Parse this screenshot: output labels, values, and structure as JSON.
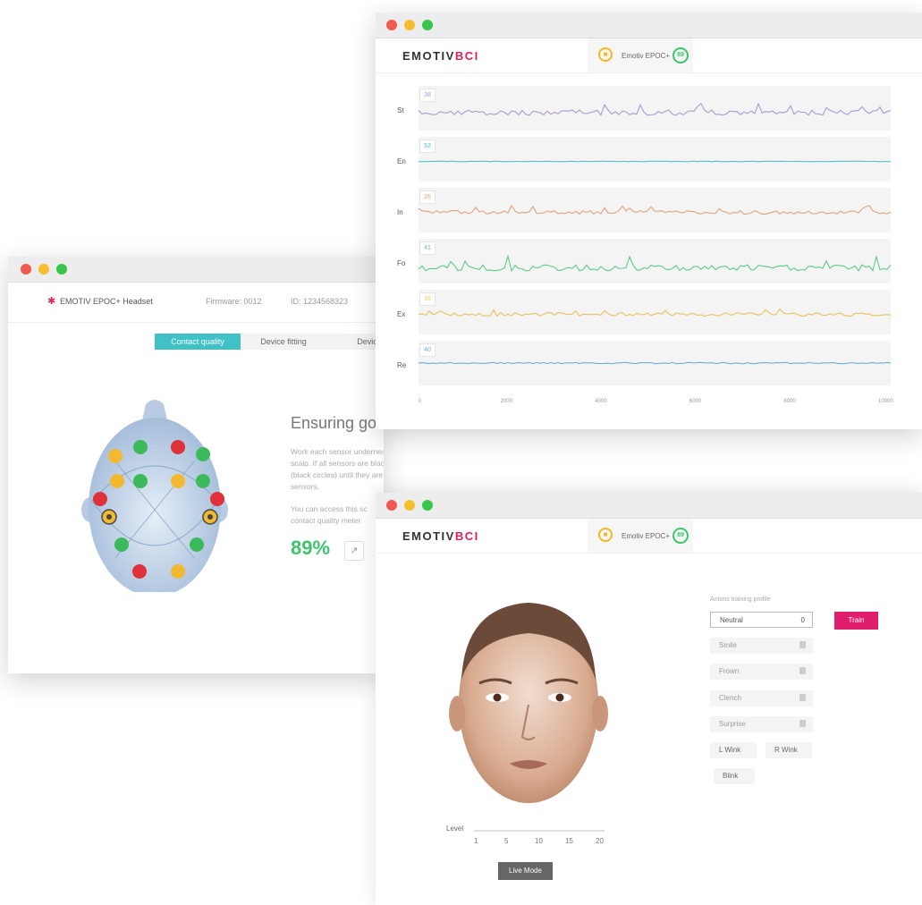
{
  "contact_window": {
    "device_name": "EMOTIV EPOC+ Headset",
    "firmware": "Firmware: 0012",
    "device_id": "ID: 1234568323",
    "tabs": [
      "Contact quality",
      "Device fitting",
      "Device"
    ],
    "heading": "Ensuring goc",
    "paragraph1": "Work each sensor underneath hair to make contact with the scalp. If all sensors are black, first adjust the reference sensors (black circles) until they are green, and then adjust the other sensors.",
    "paragraph2": "You can access this sc contact quality meter",
    "quality_percent": "89%",
    "sensor_colors": {
      "green": "#3cb95a",
      "yellow": "#f2b830",
      "red": "#e0303a"
    }
  },
  "performance_window": {
    "logo_main": "EMOTIV",
    "logo_accent": "BCI",
    "device_tab": "Emotiv EPOC+",
    "battery": "89",
    "channels": [
      {
        "label": "St",
        "value": "38",
        "color": "#a89bd0"
      },
      {
        "label": "En",
        "value": "52",
        "color": "#56c1cc"
      },
      {
        "label": "In",
        "value": "26",
        "color": "#e2a27a"
      },
      {
        "label": "Fo",
        "value": "41",
        "color": "#5ccb8a"
      },
      {
        "label": "Ex",
        "value": "16",
        "color": "#e8c15a"
      },
      {
        "label": "Re",
        "value": "40",
        "color": "#6aaed8"
      }
    ],
    "x_ticks": [
      "0",
      "2000",
      "4000",
      "6000",
      "8000",
      "10000"
    ]
  },
  "training_window": {
    "logo_main": "EMOTIV",
    "logo_accent": "BCI",
    "device_tab": "Emotiv EPOC+",
    "battery": "89",
    "profile_label": "Antons training profile",
    "neutral": {
      "label": "Neutral",
      "count": "0"
    },
    "locked_actions": [
      "Smile",
      "Frown",
      "Clench",
      "Surprise"
    ],
    "wink_left": "L Wink",
    "wink_right": "R Wink",
    "blink": "Blink",
    "train_button": "Train",
    "level_label": "Level",
    "level_ticks": [
      "1",
      "5",
      "10",
      "15",
      "20"
    ],
    "live_mode_button": "Live Mode"
  }
}
